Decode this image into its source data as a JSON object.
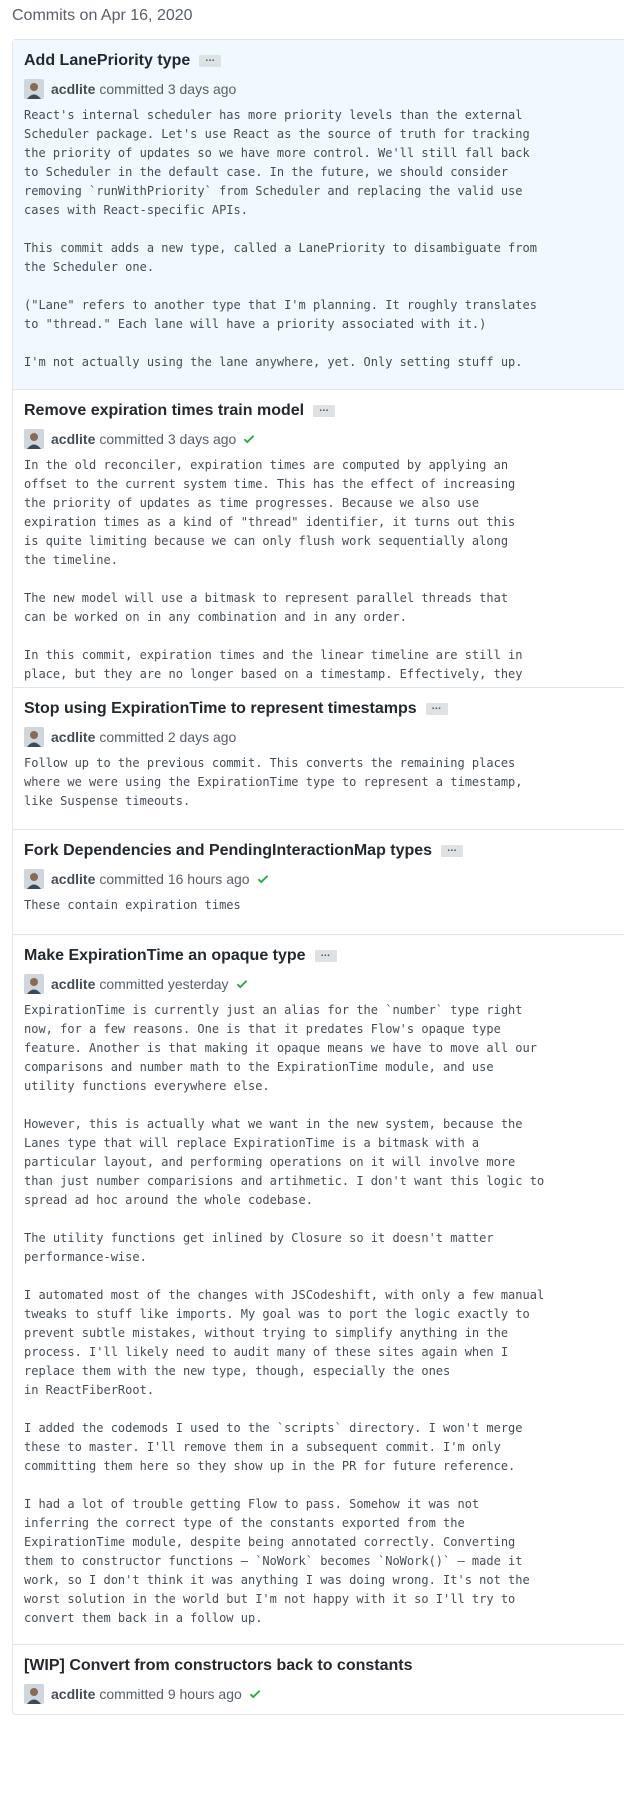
{
  "date_header": "Commits on Apr 16, 2020",
  "ellipsis_label": "…",
  "commits": [
    {
      "title": "Add LanePriority type",
      "author": "acdlite",
      "committed": "committed 3 days ago",
      "check": false,
      "body": "React's internal scheduler has more priority levels than the external\nScheduler package. Let's use React as the source of truth for tracking\nthe priority of updates so we have more control. We'll still fall back\nto Scheduler in the default case. In the future, we should consider\nremoving `runWithPriority` from Scheduler and replacing the valid use\ncases with React-specific APIs.\n\nThis commit adds a new type, called a LanePriority to disambiguate from\nthe Scheduler one.\n\n(\"Lane\" refers to another type that I'm planning. It roughly translates\nto \"thread.\" Each lane will have a priority associated with it.)\n\nI'm not actually using the lane anywhere, yet. Only setting stuff up."
    },
    {
      "title": "Remove expiration times train model",
      "author": "acdlite",
      "committed": "committed 3 days ago",
      "check": true,
      "body": "In the old reconciler, expiration times are computed by applying an\noffset to the current system time. This has the effect of increasing\nthe priority of updates as time progresses. Because we also use\nexpiration times as a kind of \"thread\" identifier, it turns out this\nis quite limiting because we can only flush work sequentially along\nthe timeline.\n\nThe new model will use a bitmask to represent parallel threads that\ncan be worked on in any combination and in any order.\n\nIn this commit, expiration times and the linear timeline are still in\nplace, but they are no longer based on a timestamp. Effectively, they\nare constants based on their priority level."
    },
    {
      "title": "Stop using ExpirationTime to represent timestamps",
      "author": "acdlite",
      "committed": "committed 2 days ago",
      "check": false,
      "body": "Follow up to the previous commit. This converts the remaining places\nwhere we were using the ExpirationTime type to represent a timestamp,\nlike Suspense timeouts."
    },
    {
      "title": "Fork Dependencies and PendingInteractionMap types",
      "author": "acdlite",
      "committed": "committed 16 hours ago",
      "check": true,
      "body": "These contain expiration times"
    },
    {
      "title": "Make ExpirationTime an opaque type",
      "author": "acdlite",
      "committed": "committed yesterday",
      "check": true,
      "body": "ExpirationTime is currently just an alias for the `number` type right\nnow, for a few reasons. One is that it predates Flow's opaque type\nfeature. Another is that making it opaque means we have to move all our\ncomparisons and number math to the ExpirationTime module, and use\nutility functions everywhere else.\n\nHowever, this is actually what we want in the new system, because the\nLanes type that will replace ExpirationTime is a bitmask with a\nparticular layout, and performing operations on it will involve more\nthan just number comparisions and artihmetic. I don't want this logic to\nspread ad hoc around the whole codebase.\n\nThe utility functions get inlined by Closure so it doesn't matter\nperformance-wise.\n\nI automated most of the changes with JSCodeshift, with only a few manual\ntweaks to stuff like imports. My goal was to port the logic exactly to\nprevent subtle mistakes, without trying to simplify anything in the\nprocess. I'll likely need to audit many of these sites again when I\nreplace them with the new type, though, especially the ones\nin ReactFiberRoot.\n\nI added the codemods I used to the `scripts` directory. I won't merge\nthese to master. I'll remove them in a subsequent commit. I'm only\ncommitting them here so they show up in the PR for future reference.\n\nI had a lot of trouble getting Flow to pass. Somehow it was not\ninferring the correct type of the constants exported from the\nExpirationTime module, despite being annotated correctly. Converting\nthem to constructor functions — `NoWork` becomes `NoWork()` — made it\nwork, so I don't think it was anything I was doing wrong. It's not the\nworst solution in the world but I'm not happy with it so I'll try to\nconvert them back in a follow up."
    },
    {
      "title": "[WIP] Convert from constructors back to constants",
      "author": "acdlite",
      "committed": "committed 9 hours ago",
      "check": true,
      "body": ""
    }
  ],
  "colors": {
    "highlight_bg": "#f1f8ff",
    "check_green": "#28a745",
    "border": "#e1e4e8"
  }
}
